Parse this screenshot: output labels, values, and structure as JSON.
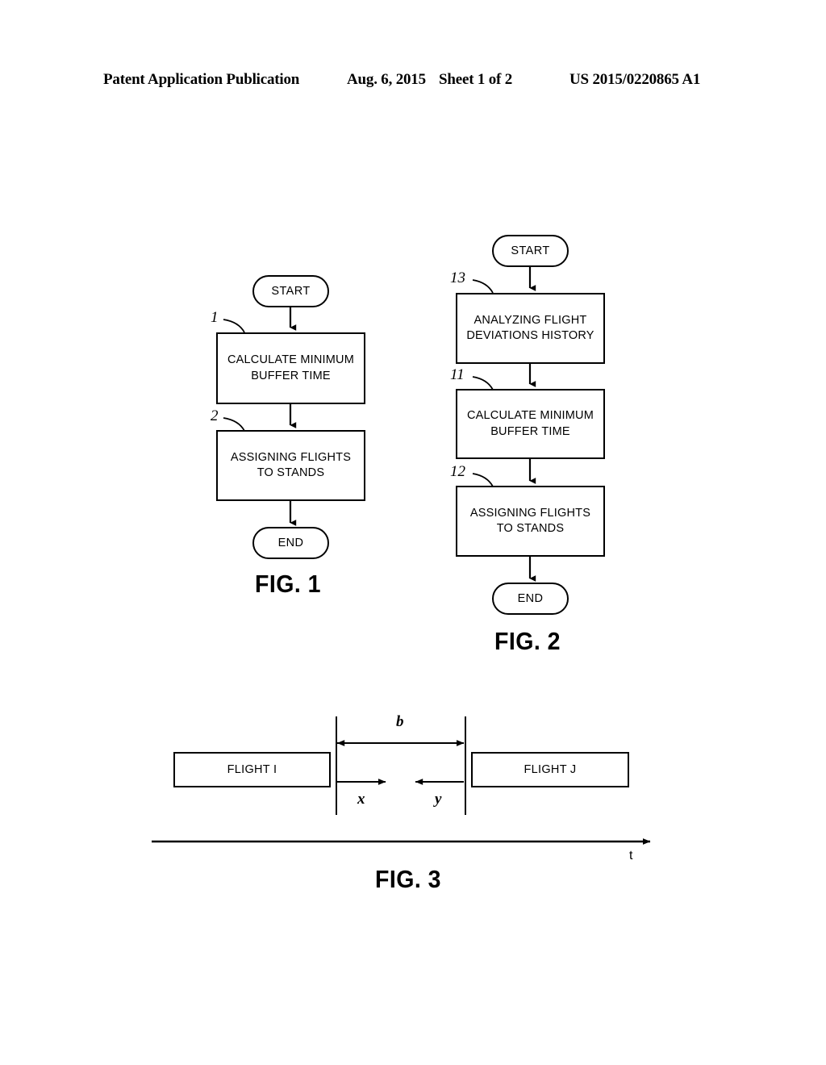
{
  "header": {
    "publication": "Patent Application Publication",
    "date": "Aug. 6, 2015",
    "sheet": "Sheet 1 of 2",
    "number": "US 2015/0220865 A1"
  },
  "figures": [
    {
      "caption": "FIG. 1",
      "nodes": [
        {
          "id": "fig1-start",
          "type": "terminator",
          "label": "START",
          "ref": ""
        },
        {
          "id": "fig1-step1",
          "type": "process",
          "label": "CALCULATE MINIMUM\nBUFFER TIME",
          "ref": "1"
        },
        {
          "id": "fig1-step2",
          "type": "process",
          "label": "ASSIGNING FLIGHTS\nTO STANDS",
          "ref": "2"
        },
        {
          "id": "fig1-end",
          "type": "terminator",
          "label": "END",
          "ref": ""
        }
      ],
      "lines": [
        {
          "text": "CALCULATE MINIMUM"
        },
        {
          "text": "BUFFER TIME"
        },
        {
          "text": "ASSIGNING FLIGHTS"
        },
        {
          "text": "TO STANDS"
        }
      ]
    },
    {
      "caption": "FIG. 2",
      "nodes": [
        {
          "id": "fig2-start",
          "type": "terminator",
          "label": "START",
          "ref": ""
        },
        {
          "id": "fig2-step13",
          "type": "process",
          "label": "ANALYZING FLIGHT\nDEVIATIONS HISTORY",
          "ref": "13"
        },
        {
          "id": "fig2-step11",
          "type": "process",
          "label": "CALCULATE MINIMUM\nBUFFER TIME",
          "ref": "11"
        },
        {
          "id": "fig2-step12",
          "type": "process",
          "label": "ASSIGNING FLIGHTS\nTO STANDS",
          "ref": "12"
        },
        {
          "id": "fig2-end",
          "type": "terminator",
          "label": "END",
          "ref": ""
        }
      ],
      "lines": [
        {
          "text": "ANALYZING FLIGHT"
        },
        {
          "text": "DEVIATIONS HISTORY"
        },
        {
          "text": "CALCULATE MINIMUM"
        },
        {
          "text": "BUFFER TIME"
        },
        {
          "text": "ASSIGNING FLIGHTS"
        },
        {
          "text": "TO STANDS"
        }
      ]
    },
    {
      "caption": "FIG. 3",
      "flights": [
        {
          "id": "flight-i",
          "label": "FLIGHT I"
        },
        {
          "id": "flight-j",
          "label": "FLIGHT J"
        }
      ],
      "measures": [
        {
          "id": "buffer",
          "label": "b",
          "description": "buffer between flights"
        },
        {
          "id": "deviation-x",
          "label": "x",
          "description": "deviation after flight i"
        },
        {
          "id": "deviation-y",
          "label": "y",
          "description": "deviation before flight j"
        }
      ],
      "axis": {
        "label": "t"
      }
    }
  ],
  "fig1": {
    "start": "START",
    "box1": {
      "ref": "1",
      "line1": "CALCULATE MINIMUM",
      "line2": "BUFFER TIME"
    },
    "box2": {
      "ref": "2",
      "line1": "ASSIGNING FLIGHTS",
      "line2": "TO STANDS"
    },
    "end": "END",
    "caption": "FIG. 1"
  },
  "fig2": {
    "start": "START",
    "box13": {
      "ref": "13",
      "line1": "ANALYZING FLIGHT",
      "line2": "DEVIATIONS HISTORY"
    },
    "box11": {
      "ref": "11",
      "line1": "CALCULATE MINIMUM",
      "line2": "BUFFER TIME"
    },
    "box12": {
      "ref": "12",
      "line1": "ASSIGNING FLIGHTS",
      "line2": "TO STANDS"
    },
    "end": "END",
    "caption": "FIG. 2"
  },
  "fig3": {
    "flight_i": "FLIGHT I",
    "flight_j": "FLIGHT J",
    "buffer_label": "b",
    "x_label": "x",
    "y_label": "y",
    "time_axis_label": "t",
    "caption": "FIG. 3"
  },
  "colors": {
    "ink": "#000000",
    "paper": "#ffffff"
  }
}
